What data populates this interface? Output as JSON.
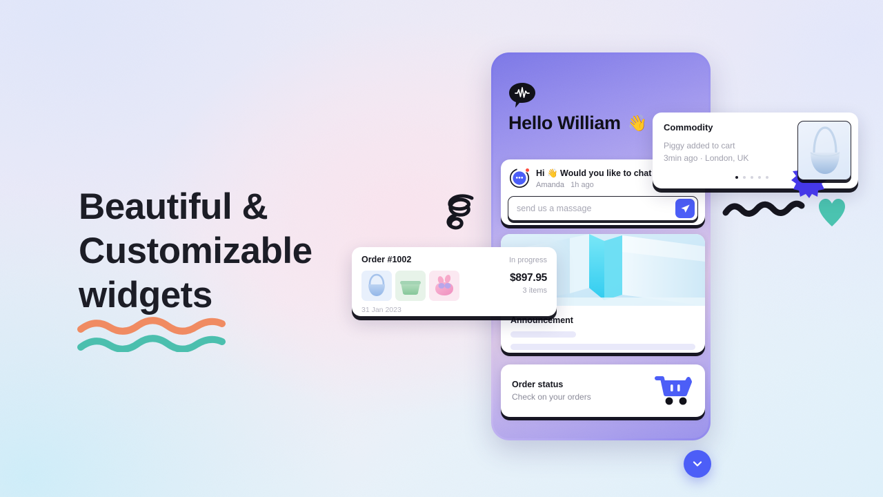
{
  "headline": {
    "line1": "Beautiful &",
    "line2": "Customizable",
    "line3": "widgets"
  },
  "phone": {
    "greeting": "Hello William",
    "greeting_emoji": "👋",
    "logo_icon": "speech-bubble-waveform-icon"
  },
  "chat_widget": {
    "message": "Hi 👋 Would you like to chat to the",
    "author": "Amanda",
    "time": "1h ago",
    "input_placeholder": "send us a massage",
    "input_value": "",
    "send_icon": "paper-plane-icon",
    "avatar_icon": "chat-bubble-icon"
  },
  "announcement": {
    "title": "Announcement"
  },
  "order_status": {
    "title": "Order status",
    "subtitle": "Check on your orders",
    "icon": "shopping-cart-icon"
  },
  "commodity_card": {
    "title": "Commodity",
    "line1": "Piggy added to cart",
    "line2": "3min ago · London, UK",
    "dots_total": 5,
    "dots_active": 1,
    "thumb_icon": "handbag-icon",
    "badge_icon": "starburst-badge-icon"
  },
  "order_card": {
    "order_id": "Order #1002",
    "status": "In progress",
    "price": "$897.95",
    "items": "3 items",
    "date": "31 Jan 2023",
    "thumbnails": [
      {
        "name": "blue-handbag-thumbnail"
      },
      {
        "name": "green-pouch-thumbnail"
      },
      {
        "name": "pink-earbuds-thumbnail"
      }
    ]
  },
  "scroll_button": {
    "icon": "chevron-down-icon"
  },
  "decorations": {
    "spiral": "spiral-doodle",
    "squiggle": "squiggle-doodle",
    "heart": "heart-doodle",
    "wave_orange": "orange-wave-underline",
    "wave_teal": "teal-wave-underline"
  },
  "colors": {
    "accent_blue": "#4c5ef7",
    "wave_orange": "#f08b62",
    "wave_teal": "#4bbfae",
    "heart_teal": "#4bc3b0",
    "ink": "#1c1d26"
  }
}
